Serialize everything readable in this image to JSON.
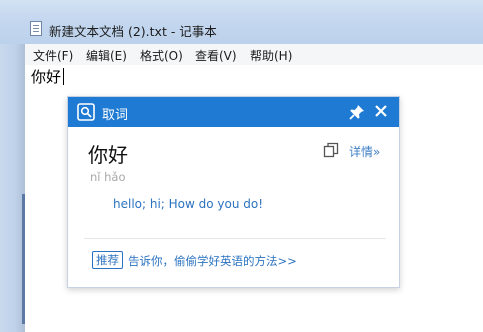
{
  "notepad": {
    "title": "新建文本文档 (2).txt - 记事本",
    "menu": [
      {
        "label": "文件(F)"
      },
      {
        "label": "编辑(E)"
      },
      {
        "label": "格式(O)"
      },
      {
        "label": "查看(V)"
      },
      {
        "label": "帮助(H)"
      }
    ],
    "content": "你好"
  },
  "dict": {
    "header_title": "取词",
    "word": "你好",
    "details_label": "详情»",
    "pinyin": "nǐ hǎo",
    "meanings": "hello;  hi;  How do you do!",
    "recommend_badge": "推荐",
    "recommend_text": "告诉你，偷偷学好英语的方法>>",
    "icons": [
      "dictionary-logo-icon",
      "pin-icon",
      "close-icon",
      "copy-icon"
    ],
    "accent_color": "#1f7ad3"
  }
}
